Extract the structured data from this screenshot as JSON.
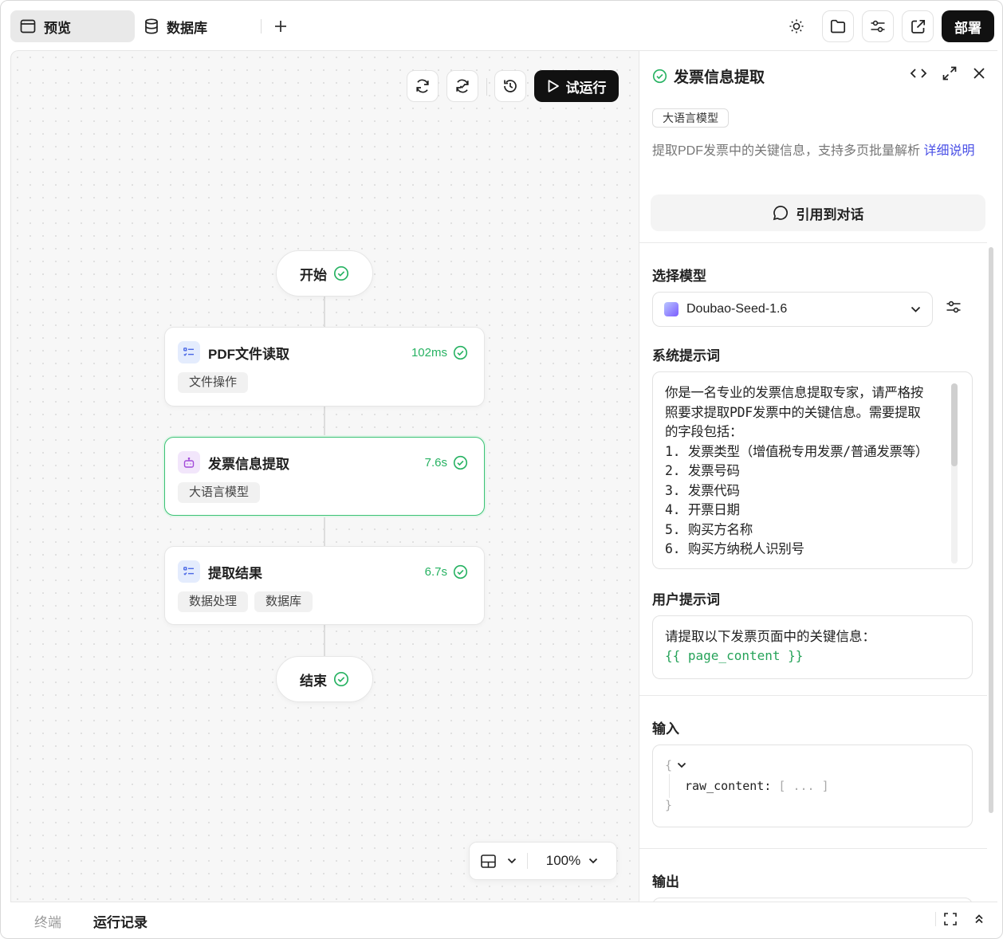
{
  "topbar": {
    "tabs": [
      {
        "label": "预览",
        "icon": "window-icon",
        "active": true
      },
      {
        "label": "数据库",
        "icon": "database-icon",
        "active": false
      }
    ],
    "add_tab_icon": "plus-icon",
    "tools": [
      "theme-sun-icon",
      "folder-icon",
      "sliders-icon",
      "external-link-icon"
    ],
    "deploy_label": "部署"
  },
  "canvas": {
    "toolbar": {
      "buttons": [
        "refresh-icon",
        "sync-icon",
        "history-icon"
      ],
      "run_label": "试运行"
    },
    "nodes": {
      "start": {
        "label": "开始",
        "status": "success"
      },
      "pdf_read": {
        "title": "PDF文件读取",
        "time": "102ms",
        "tags": [
          "文件操作"
        ]
      },
      "invoice_extract": {
        "title": "发票信息提取",
        "time": "7.6s",
        "tags": [
          "大语言模型"
        ],
        "selected": true
      },
      "result": {
        "title": "提取结果",
        "time": "6.7s",
        "tags": [
          "数据处理",
          "数据库"
        ]
      },
      "end": {
        "label": "结束",
        "status": "success"
      }
    },
    "zoom": {
      "value": "100%"
    }
  },
  "panel": {
    "title": "发票信息提取",
    "tag": "大语言模型",
    "description": "提取PDF发票中的关键信息，支持多页批量解析",
    "description_link": "详细说明",
    "quote_button": "引用到对话",
    "model_section": {
      "label": "选择模型",
      "model": "Doubao-Seed-1.6"
    },
    "system_prompt": {
      "label": "系统提示词",
      "lines": [
        "你是一名专业的发票信息提取专家，请严格按",
        "照要求提取PDF发票中的关键信息。需要提取",
        "的字段包括：",
        "1. 发票类型（增值税专用发票/普通发票等）",
        "2. 发票号码",
        "3. 发票代码",
        "4. 开票日期",
        "5. 购买方名称",
        "6. 购买方纳税人识别号"
      ]
    },
    "user_prompt": {
      "label": "用户提示词",
      "text": "请提取以下发票页面中的关键信息：",
      "variable": "{{ page_content }}"
    },
    "input": {
      "label": "输入",
      "open_brace": "{",
      "key": "raw_content:",
      "value": "[ ... ]",
      "close_brace": "}"
    },
    "output": {
      "label": "输出"
    }
  },
  "bottombar": {
    "tabs": [
      {
        "label": "终端",
        "active": false
      },
      {
        "label": "运行记录",
        "active": true
      }
    ]
  },
  "colors": {
    "accent_green": "#27b262",
    "link": "#4a50e6",
    "dark_button": "#111111"
  }
}
